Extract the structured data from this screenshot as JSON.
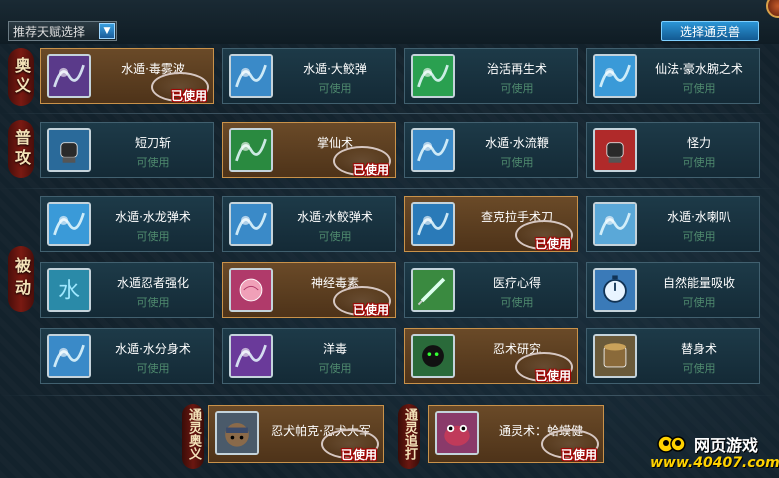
{
  "header": {
    "talent_select": "推荐天赋选择",
    "summon_button": "选择通灵兽"
  },
  "sections": {
    "ougi": "奥义",
    "normal": "普攻",
    "passive": "被动",
    "summon_ougi": "通灵奥义",
    "summon_chase": "通灵追打"
  },
  "status": {
    "available": "可使用",
    "used": "已使用"
  },
  "ougi": [
    {
      "name": "水遁·毒雾波",
      "used": true,
      "icon": "poison-mist-icon",
      "color": "#5a3a8a"
    },
    {
      "name": "水遁·大鲛弹",
      "used": false,
      "icon": "shark-icon",
      "color": "#3a8ac8"
    },
    {
      "name": "治活再生术",
      "used": false,
      "icon": "healing-hand-icon",
      "color": "#2aa050"
    },
    {
      "name": "仙法·豪水腕之术",
      "used": false,
      "icon": "water-arm-icon",
      "color": "#3a9ad8"
    }
  ],
  "normal": [
    {
      "name": "短刀斩",
      "used": false,
      "icon": "fist-icon",
      "color": "#2a6a9a"
    },
    {
      "name": "掌仙术",
      "used": true,
      "icon": "palm-heal-icon",
      "color": "#2a8a40"
    },
    {
      "name": "水遁·水流鞭",
      "used": false,
      "icon": "water-whip-icon",
      "color": "#3a8ac8"
    },
    {
      "name": "怪力",
      "used": false,
      "icon": "strength-fist-icon",
      "color": "#b02a2a"
    }
  ],
  "passive": [
    {
      "name": "水遁·水龙弹术",
      "used": false,
      "icon": "water-dragon-icon",
      "color": "#3a9ad8"
    },
    {
      "name": "水遁·水鲛弹术",
      "used": false,
      "icon": "water-shark-icon",
      "color": "#3a8ac8"
    },
    {
      "name": "查克拉手术刀",
      "used": true,
      "icon": "chakra-scalpel-icon",
      "color": "#2a7ab8"
    },
    {
      "name": "水遁·水喇叭",
      "used": false,
      "icon": "ice-spikes-icon",
      "color": "#5aa8d8"
    },
    {
      "name": "水遁忍者强化",
      "used": false,
      "icon": "water-kanji-icon",
      "color": "#2a8aa8"
    },
    {
      "name": "神经毒素",
      "used": true,
      "icon": "brain-toxin-icon",
      "color": "#b03a6a"
    },
    {
      "name": "医疗心得",
      "used": false,
      "icon": "syringe-icon",
      "color": "#3a8a40"
    },
    {
      "name": "自然能量吸收",
      "used": false,
      "icon": "stopwatch-icon",
      "color": "#3a7ab8"
    },
    {
      "name": "水遁·水分身术",
      "used": false,
      "icon": "water-clone-icon",
      "color": "#3a8ac8"
    },
    {
      "name": "洋毒",
      "used": false,
      "icon": "poison-blade-icon",
      "color": "#6a3a9a"
    },
    {
      "name": "忍术研究",
      "used": true,
      "icon": "ninja-research-icon",
      "color": "#2a6a3a"
    },
    {
      "name": "替身术",
      "used": false,
      "icon": "log-substitute-icon",
      "color": "#6a5a3a"
    }
  ],
  "summon": [
    {
      "name": "忍犬帕克·忍犬大军",
      "used": true,
      "icon": "ninja-dog-icon",
      "color": "#4a5a6a"
    },
    {
      "name": "通灵术：蛤蟆健",
      "used": true,
      "icon": "toad-icon",
      "color": "#8a3a6a"
    }
  ],
  "logo": {
    "title": "网页游戏",
    "url": "www.40407.com"
  }
}
